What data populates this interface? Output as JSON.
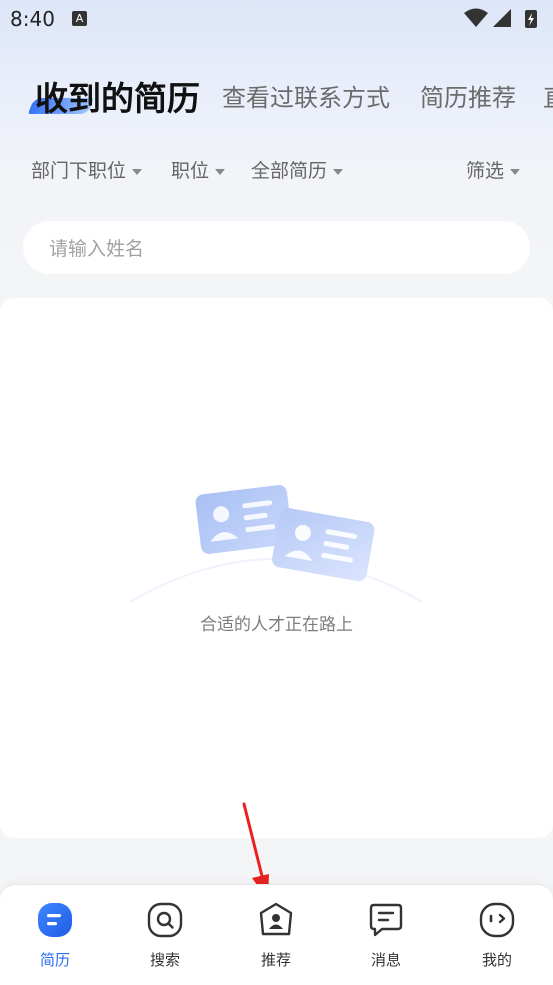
{
  "status_bar": {
    "time": "8:40",
    "notification_icon": "a-letter-icon",
    "system_icons": [
      "wifi-icon",
      "signal-icon",
      "battery-charging-icon"
    ]
  },
  "tabs": [
    {
      "label": "收到的简历",
      "active": true
    },
    {
      "label": "查看过联系方式",
      "active": false
    },
    {
      "label": "简历推荐",
      "active": false
    },
    {
      "label": "直",
      "active": false
    }
  ],
  "filters": {
    "department": "部门下职位",
    "position": "职位",
    "resume": "全部简历",
    "screen": "筛选"
  },
  "search": {
    "placeholder": "请输入姓名",
    "value": ""
  },
  "empty_state": {
    "message": "合适的人才正在路上",
    "illustration": "resume-cards-icon"
  },
  "bottom_nav": [
    {
      "label": "简历",
      "icon": "resume-icon",
      "active": true
    },
    {
      "label": "搜索",
      "icon": "search-icon",
      "active": false
    },
    {
      "label": "推荐",
      "icon": "recommend-icon",
      "active": false
    },
    {
      "label": "消息",
      "icon": "message-icon",
      "active": false
    },
    {
      "label": "我的",
      "icon": "profile-icon",
      "active": false
    }
  ],
  "colors": {
    "accent": "#2b6ef2",
    "annotation_arrow": "#e8231f",
    "background": "#f4f5f7"
  }
}
